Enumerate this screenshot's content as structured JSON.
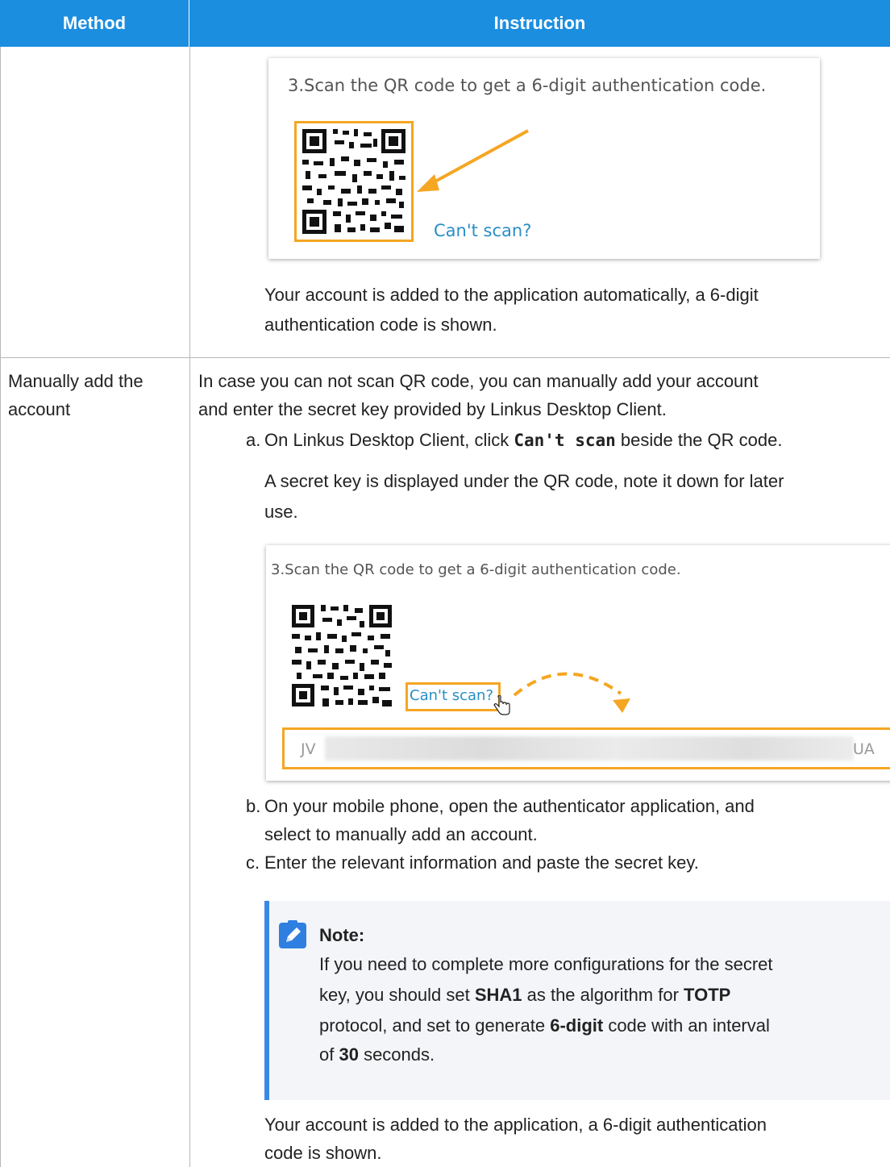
{
  "table": {
    "headers": {
      "method": "Method",
      "instruction": "Instruction"
    }
  },
  "row1": {
    "screenshot_caption": "3.Scan the QR code to get a 6-digit authentication code.",
    "cant_scan_link": "Can't scan?",
    "result_line1": "Your account is added to the application automatically, a 6-digit",
    "result_line2": "authentication code is shown."
  },
  "row2": {
    "method_line1": "Manually add the",
    "method_line2": "account",
    "intro_line1": "In case you can not scan QR code, you can manually add your account",
    "intro_line2": "and enter the secret key provided by Linkus Desktop Client.",
    "step_a": {
      "marker": "a.",
      "pre": "On Linkus Desktop Client, click ",
      "code": "Can't scan",
      "post": " beside the QR code."
    },
    "step_a_detail_line1": "A secret key is displayed under the QR code, note it down for later",
    "step_a_detail_line2": "use.",
    "screenshot2": {
      "caption": "3.Scan the QR code to get a 6-digit authentication code.",
      "cant_scan_link": "Can't scan?",
      "key_prefix": "JV",
      "key_suffix": "UA"
    },
    "step_b": {
      "marker": "b.",
      "line1": "On your mobile phone, open the authenticator application, and",
      "line2": "select to manually add an account."
    },
    "step_c": {
      "marker": "c.",
      "text": "Enter the relevant information and paste the secret key."
    },
    "note": {
      "title": "Note:",
      "line1": "If you need to complete more configurations for the secret",
      "line2_pre": "key, you should set ",
      "sha1": "SHA1",
      "line2_mid": " as the algorithm for ",
      "totp": "TOTP",
      "line3_pre": "protocol, and set to generate ",
      "six_digit": "6-digit",
      "line3_post": " code with an interval",
      "line4_pre": "of ",
      "thirty": "30",
      "line4_post": " seconds."
    },
    "result_line1": "Your account is added to the application, a 6-digit authentication",
    "result_line2": "code is shown."
  },
  "colors": {
    "header_bg": "#1B8EE0",
    "highlight": "#F5A623",
    "note_bar": "#3B88E6",
    "link": "#2A8EC7"
  }
}
